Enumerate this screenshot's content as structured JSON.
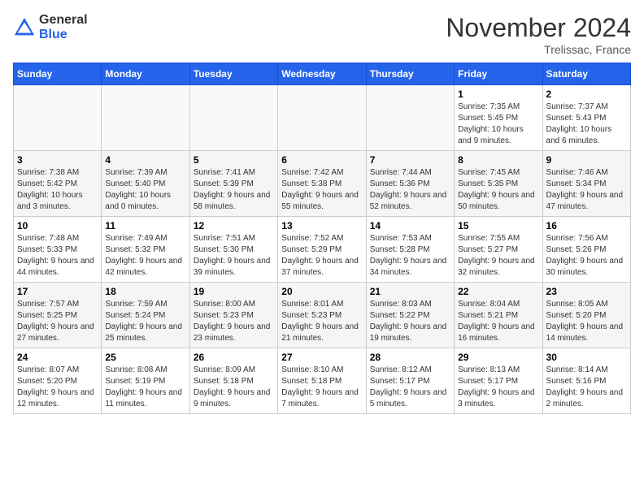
{
  "header": {
    "logo": {
      "general": "General",
      "blue": "Blue"
    },
    "month": "November 2024",
    "location": "Trelissac, France"
  },
  "weekdays": [
    "Sunday",
    "Monday",
    "Tuesday",
    "Wednesday",
    "Thursday",
    "Friday",
    "Saturday"
  ],
  "weeks": [
    [
      null,
      null,
      null,
      null,
      null,
      {
        "day": "1",
        "sunrise": "Sunrise: 7:35 AM",
        "sunset": "Sunset: 5:45 PM",
        "daylight": "Daylight: 10 hours and 9 minutes."
      },
      {
        "day": "2",
        "sunrise": "Sunrise: 7:37 AM",
        "sunset": "Sunset: 5:43 PM",
        "daylight": "Daylight: 10 hours and 6 minutes."
      }
    ],
    [
      {
        "day": "3",
        "sunrise": "Sunrise: 7:38 AM",
        "sunset": "Sunset: 5:42 PM",
        "daylight": "Daylight: 10 hours and 3 minutes."
      },
      {
        "day": "4",
        "sunrise": "Sunrise: 7:39 AM",
        "sunset": "Sunset: 5:40 PM",
        "daylight": "Daylight: 10 hours and 0 minutes."
      },
      {
        "day": "5",
        "sunrise": "Sunrise: 7:41 AM",
        "sunset": "Sunset: 5:39 PM",
        "daylight": "Daylight: 9 hours and 58 minutes."
      },
      {
        "day": "6",
        "sunrise": "Sunrise: 7:42 AM",
        "sunset": "Sunset: 5:38 PM",
        "daylight": "Daylight: 9 hours and 55 minutes."
      },
      {
        "day": "7",
        "sunrise": "Sunrise: 7:44 AM",
        "sunset": "Sunset: 5:36 PM",
        "daylight": "Daylight: 9 hours and 52 minutes."
      },
      {
        "day": "8",
        "sunrise": "Sunrise: 7:45 AM",
        "sunset": "Sunset: 5:35 PM",
        "daylight": "Daylight: 9 hours and 50 minutes."
      },
      {
        "day": "9",
        "sunrise": "Sunrise: 7:46 AM",
        "sunset": "Sunset: 5:34 PM",
        "daylight": "Daylight: 9 hours and 47 minutes."
      }
    ],
    [
      {
        "day": "10",
        "sunrise": "Sunrise: 7:48 AM",
        "sunset": "Sunset: 5:33 PM",
        "daylight": "Daylight: 9 hours and 44 minutes."
      },
      {
        "day": "11",
        "sunrise": "Sunrise: 7:49 AM",
        "sunset": "Sunset: 5:32 PM",
        "daylight": "Daylight: 9 hours and 42 minutes."
      },
      {
        "day": "12",
        "sunrise": "Sunrise: 7:51 AM",
        "sunset": "Sunset: 5:30 PM",
        "daylight": "Daylight: 9 hours and 39 minutes."
      },
      {
        "day": "13",
        "sunrise": "Sunrise: 7:52 AM",
        "sunset": "Sunset: 5:29 PM",
        "daylight": "Daylight: 9 hours and 37 minutes."
      },
      {
        "day": "14",
        "sunrise": "Sunrise: 7:53 AM",
        "sunset": "Sunset: 5:28 PM",
        "daylight": "Daylight: 9 hours and 34 minutes."
      },
      {
        "day": "15",
        "sunrise": "Sunrise: 7:55 AM",
        "sunset": "Sunset: 5:27 PM",
        "daylight": "Daylight: 9 hours and 32 minutes."
      },
      {
        "day": "16",
        "sunrise": "Sunrise: 7:56 AM",
        "sunset": "Sunset: 5:26 PM",
        "daylight": "Daylight: 9 hours and 30 minutes."
      }
    ],
    [
      {
        "day": "17",
        "sunrise": "Sunrise: 7:57 AM",
        "sunset": "Sunset: 5:25 PM",
        "daylight": "Daylight: 9 hours and 27 minutes."
      },
      {
        "day": "18",
        "sunrise": "Sunrise: 7:59 AM",
        "sunset": "Sunset: 5:24 PM",
        "daylight": "Daylight: 9 hours and 25 minutes."
      },
      {
        "day": "19",
        "sunrise": "Sunrise: 8:00 AM",
        "sunset": "Sunset: 5:23 PM",
        "daylight": "Daylight: 9 hours and 23 minutes."
      },
      {
        "day": "20",
        "sunrise": "Sunrise: 8:01 AM",
        "sunset": "Sunset: 5:23 PM",
        "daylight": "Daylight: 9 hours and 21 minutes."
      },
      {
        "day": "21",
        "sunrise": "Sunrise: 8:03 AM",
        "sunset": "Sunset: 5:22 PM",
        "daylight": "Daylight: 9 hours and 19 minutes."
      },
      {
        "day": "22",
        "sunrise": "Sunrise: 8:04 AM",
        "sunset": "Sunset: 5:21 PM",
        "daylight": "Daylight: 9 hours and 16 minutes."
      },
      {
        "day": "23",
        "sunrise": "Sunrise: 8:05 AM",
        "sunset": "Sunset: 5:20 PM",
        "daylight": "Daylight: 9 hours and 14 minutes."
      }
    ],
    [
      {
        "day": "24",
        "sunrise": "Sunrise: 8:07 AM",
        "sunset": "Sunset: 5:20 PM",
        "daylight": "Daylight: 9 hours and 12 minutes."
      },
      {
        "day": "25",
        "sunrise": "Sunrise: 8:08 AM",
        "sunset": "Sunset: 5:19 PM",
        "daylight": "Daylight: 9 hours and 11 minutes."
      },
      {
        "day": "26",
        "sunrise": "Sunrise: 8:09 AM",
        "sunset": "Sunset: 5:18 PM",
        "daylight": "Daylight: 9 hours and 9 minutes."
      },
      {
        "day": "27",
        "sunrise": "Sunrise: 8:10 AM",
        "sunset": "Sunset: 5:18 PM",
        "daylight": "Daylight: 9 hours and 7 minutes."
      },
      {
        "day": "28",
        "sunrise": "Sunrise: 8:12 AM",
        "sunset": "Sunset: 5:17 PM",
        "daylight": "Daylight: 9 hours and 5 minutes."
      },
      {
        "day": "29",
        "sunrise": "Sunrise: 8:13 AM",
        "sunset": "Sunset: 5:17 PM",
        "daylight": "Daylight: 9 hours and 3 minutes."
      },
      {
        "day": "30",
        "sunrise": "Sunrise: 8:14 AM",
        "sunset": "Sunset: 5:16 PM",
        "daylight": "Daylight: 9 hours and 2 minutes."
      }
    ]
  ]
}
